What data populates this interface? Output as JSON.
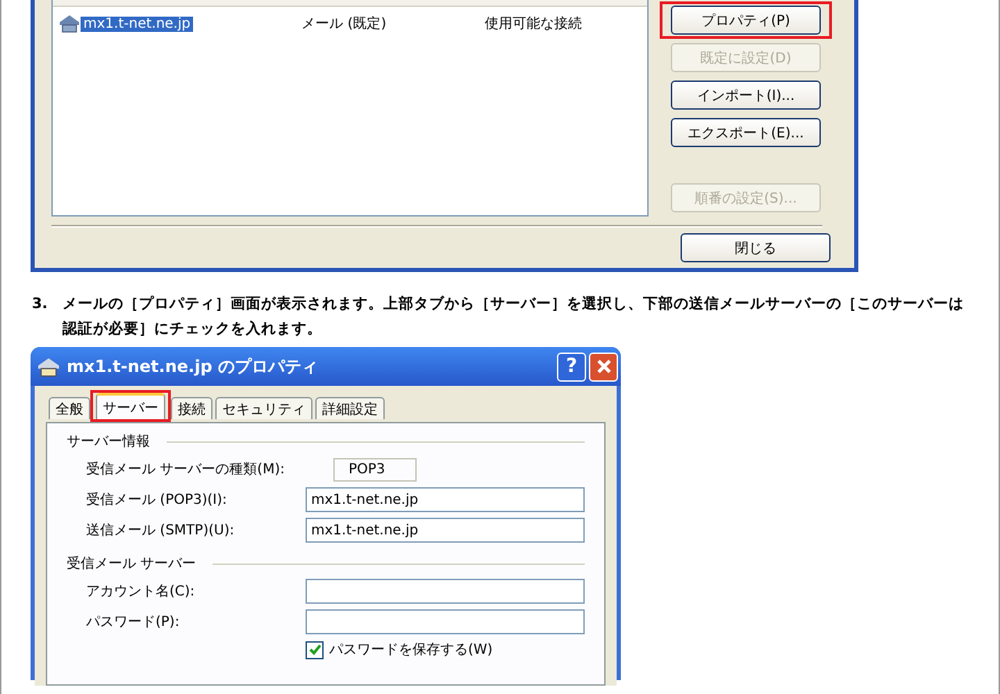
{
  "accounts_dialog": {
    "accounts": [
      {
        "name": "mx1.t-net.ne.jp",
        "type": "メール (既定)",
        "connection": "使用可能な接続",
        "selected": true
      }
    ],
    "buttons": [
      {
        "label": "プロパティ(P)",
        "disabled": false,
        "highlighted": true
      },
      {
        "label": "既定に設定(D)",
        "disabled": true,
        "highlighted": false
      },
      {
        "label": "インポート(I)...",
        "disabled": false,
        "highlighted": false
      },
      {
        "label": "エクスポート(E)...",
        "disabled": false,
        "highlighted": false
      }
    ],
    "order_button": {
      "label": "順番の設定(S)...",
      "disabled": true
    },
    "close_button": "閉じる"
  },
  "instruction": {
    "number": "3.",
    "text": "メールの［プロパティ］画面が表示されます。上部タブから［サーバー］を選択し、下部の送信メールサーバーの［このサーバーは認証が必要］にチェックを入れます。"
  },
  "properties_dialog": {
    "title": "mx1.t-net.ne.jp のプロパティ",
    "help_button": "?",
    "tabs": [
      {
        "label": "全般",
        "selected": false,
        "highlighted": false
      },
      {
        "label": "サーバー",
        "selected": true,
        "highlighted": true
      },
      {
        "label": "接続",
        "selected": false,
        "highlighted": false
      },
      {
        "label": "セキュリティ",
        "selected": false,
        "highlighted": false
      },
      {
        "label": "詳細設定",
        "selected": false,
        "highlighted": false
      }
    ],
    "sections": [
      {
        "title": "サーバー情報",
        "fields": [
          {
            "label": "受信メール サーバーの種類(M):",
            "value": "POP3",
            "kind": "readonly"
          },
          {
            "label": "受信メール (POP3)(I):",
            "value": "mx1.t-net.ne.jp",
            "kind": "text"
          },
          {
            "label": "送信メール (SMTP)(U):",
            "value": "mx1.t-net.ne.jp",
            "kind": "text"
          }
        ]
      },
      {
        "title": "受信メール サーバー",
        "fields": [
          {
            "label": "アカウント名(C):",
            "kind": "text"
          },
          {
            "label": "パスワード(P):",
            "kind": "text"
          }
        ],
        "checkbox": {
          "label": "パスワードを保存する(W)",
          "checked": true
        }
      }
    ]
  }
}
